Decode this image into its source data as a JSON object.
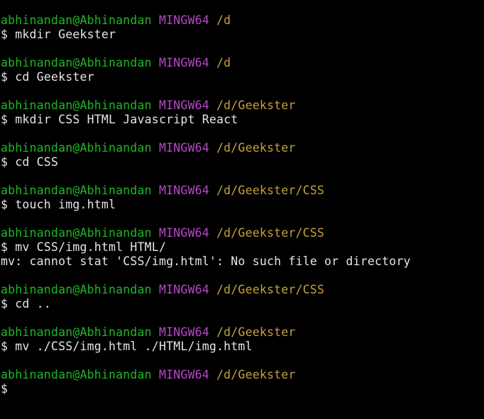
{
  "terminal": {
    "colors": {
      "background": "#000000",
      "user": "#1fb626",
      "shell": "#b548c6",
      "path": "#c5a13a",
      "text": "#e6e6e6"
    },
    "blocks": [
      {
        "user": "abhinandan@Abhinandan",
        "shell": "MINGW64",
        "path": "/d",
        "command": "$ mkdir Geekster",
        "output": ""
      },
      {
        "user": "abhinandan@Abhinandan",
        "shell": "MINGW64",
        "path": "/d",
        "command": "$ cd Geekster",
        "output": ""
      },
      {
        "user": "abhinandan@Abhinandan",
        "shell": "MINGW64",
        "path": "/d/Geekster",
        "command": "$ mkdir CSS HTML Javascript React",
        "output": ""
      },
      {
        "user": "abhinandan@Abhinandan",
        "shell": "MINGW64",
        "path": "/d/Geekster",
        "command": "$ cd CSS",
        "output": ""
      },
      {
        "user": "abhinandan@Abhinandan",
        "shell": "MINGW64",
        "path": "/d/Geekster/CSS",
        "command": "$ touch img.html",
        "output": ""
      },
      {
        "user": "abhinandan@Abhinandan",
        "shell": "MINGW64",
        "path": "/d/Geekster/CSS",
        "command": "$ mv CSS/img.html HTML/",
        "output": "mv: cannot stat 'CSS/img.html': No such file or directory"
      },
      {
        "user": "abhinandan@Abhinandan",
        "shell": "MINGW64",
        "path": "/d/Geekster/CSS",
        "command": "$ cd ..",
        "output": ""
      },
      {
        "user": "abhinandan@Abhinandan",
        "shell": "MINGW64",
        "path": "/d/Geekster",
        "command": "$ mv ./CSS/img.html ./HTML/img.html",
        "output": ""
      },
      {
        "user": "abhinandan@Abhinandan",
        "shell": "MINGW64",
        "path": "/d/Geekster",
        "command": "$",
        "output": ""
      }
    ]
  }
}
